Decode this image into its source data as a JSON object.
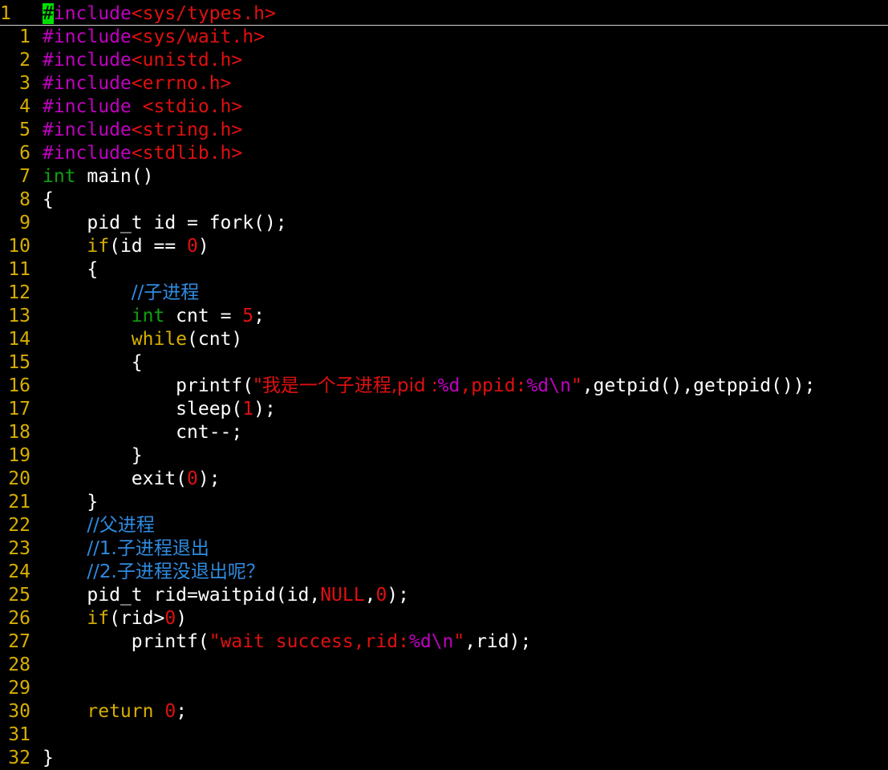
{
  "editor": {
    "colors": {
      "background": "#000000",
      "line_number": "#d7af00",
      "preprocessor": "#c000c0",
      "string": "#e01010",
      "type": "#10a010",
      "keyword": "#d7af00",
      "comment": "#2f8be0",
      "cursor": "#00e000"
    },
    "lines": [
      {
        "n": "1",
        "tokens": [
          {
            "t": "#",
            "c": "cursor"
          },
          {
            "t": "include",
            "c": "pre"
          },
          {
            "t": "<sys/types.h>",
            "c": "str"
          }
        ]
      },
      {
        "n": "1",
        "tokens": [
          {
            "t": "#include",
            "c": "pre"
          },
          {
            "t": "<sys/wait.h>",
            "c": "str"
          }
        ]
      },
      {
        "n": "2",
        "tokens": [
          {
            "t": "#include",
            "c": "pre"
          },
          {
            "t": "<unistd.h>",
            "c": "str"
          }
        ]
      },
      {
        "n": "3",
        "tokens": [
          {
            "t": "#include",
            "c": "pre"
          },
          {
            "t": "<errno.h>",
            "c": "str"
          }
        ]
      },
      {
        "n": "4",
        "tokens": [
          {
            "t": "#include ",
            "c": "pre"
          },
          {
            "t": "<stdio.h>",
            "c": "str"
          }
        ]
      },
      {
        "n": "5",
        "tokens": [
          {
            "t": "#include",
            "c": "pre"
          },
          {
            "t": "<string.h>",
            "c": "str"
          }
        ]
      },
      {
        "n": "6",
        "tokens": [
          {
            "t": "#include",
            "c": "pre"
          },
          {
            "t": "<stdlib.h>",
            "c": "str"
          }
        ]
      },
      {
        "n": "7",
        "tokens": [
          {
            "t": "int",
            "c": "type"
          },
          {
            "t": " main()",
            "c": "def"
          }
        ]
      },
      {
        "n": "8",
        "tokens": [
          {
            "t": "{",
            "c": "def"
          }
        ]
      },
      {
        "n": "9",
        "tokens": [
          {
            "t": "    pid_t id = fork();",
            "c": "def"
          }
        ]
      },
      {
        "n": "10",
        "tokens": [
          {
            "t": "    ",
            "c": "def"
          },
          {
            "t": "if",
            "c": "kw"
          },
          {
            "t": "(id == ",
            "c": "def"
          },
          {
            "t": "0",
            "c": "num"
          },
          {
            "t": ")",
            "c": "def"
          }
        ]
      },
      {
        "n": "11",
        "tokens": [
          {
            "t": "    {",
            "c": "def"
          }
        ]
      },
      {
        "n": "12",
        "tokens": [
          {
            "t": "        ",
            "c": "def"
          },
          {
            "t": "//子进程",
            "c": "cmt"
          }
        ]
      },
      {
        "n": "13",
        "tokens": [
          {
            "t": "        ",
            "c": "def"
          },
          {
            "t": "int",
            "c": "type"
          },
          {
            "t": " cnt = ",
            "c": "def"
          },
          {
            "t": "5",
            "c": "num"
          },
          {
            "t": ";",
            "c": "def"
          }
        ]
      },
      {
        "n": "14",
        "tokens": [
          {
            "t": "        ",
            "c": "def"
          },
          {
            "t": "while",
            "c": "kw"
          },
          {
            "t": "(cnt)",
            "c": "def"
          }
        ]
      },
      {
        "n": "15",
        "tokens": [
          {
            "t": "        {",
            "c": "def"
          }
        ]
      },
      {
        "n": "16",
        "tokens": [
          {
            "t": "            printf(",
            "c": "def"
          },
          {
            "t": "\"我是一个子进程,pid :",
            "c": "str"
          },
          {
            "t": "%d",
            "c": "fmt"
          },
          {
            "t": ",ppid:",
            "c": "str"
          },
          {
            "t": "%d\\n",
            "c": "fmt"
          },
          {
            "t": "\"",
            "c": "str"
          },
          {
            "t": ",getpid(),getppid());",
            "c": "def"
          }
        ]
      },
      {
        "n": "17",
        "tokens": [
          {
            "t": "            sleep(",
            "c": "def"
          },
          {
            "t": "1",
            "c": "num"
          },
          {
            "t": ");",
            "c": "def"
          }
        ]
      },
      {
        "n": "18",
        "tokens": [
          {
            "t": "            cnt--;",
            "c": "def"
          }
        ]
      },
      {
        "n": "19",
        "tokens": [
          {
            "t": "        }",
            "c": "def"
          }
        ]
      },
      {
        "n": "20",
        "tokens": [
          {
            "t": "        exit(",
            "c": "def"
          },
          {
            "t": "0",
            "c": "num"
          },
          {
            "t": ");",
            "c": "def"
          }
        ]
      },
      {
        "n": "21",
        "tokens": [
          {
            "t": "    }",
            "c": "def"
          }
        ]
      },
      {
        "n": "22",
        "tokens": [
          {
            "t": "    ",
            "c": "def"
          },
          {
            "t": "//父进程",
            "c": "cmt"
          }
        ]
      },
      {
        "n": "23",
        "tokens": [
          {
            "t": "    ",
            "c": "def"
          },
          {
            "t": "//1.子进程退出",
            "c": "cmt"
          }
        ]
      },
      {
        "n": "24",
        "tokens": [
          {
            "t": "    ",
            "c": "def"
          },
          {
            "t": "//2.子进程没退出呢？",
            "c": "cmt"
          }
        ]
      },
      {
        "n": "25",
        "tokens": [
          {
            "t": "    pid_t rid=waitpid(id,",
            "c": "def"
          },
          {
            "t": "NULL",
            "c": "num"
          },
          {
            "t": ",",
            "c": "def"
          },
          {
            "t": "0",
            "c": "num"
          },
          {
            "t": ");",
            "c": "def"
          }
        ]
      },
      {
        "n": "26",
        "tokens": [
          {
            "t": "    ",
            "c": "def"
          },
          {
            "t": "if",
            "c": "kw"
          },
          {
            "t": "(rid>",
            "c": "def"
          },
          {
            "t": "0",
            "c": "num"
          },
          {
            "t": ")",
            "c": "def"
          }
        ]
      },
      {
        "n": "27",
        "tokens": [
          {
            "t": "        printf(",
            "c": "def"
          },
          {
            "t": "\"wait success,rid:",
            "c": "str"
          },
          {
            "t": "%d\\n",
            "c": "fmt"
          },
          {
            "t": "\"",
            "c": "str"
          },
          {
            "t": ",rid);",
            "c": "def"
          }
        ]
      },
      {
        "n": "28",
        "tokens": []
      },
      {
        "n": "29",
        "tokens": []
      },
      {
        "n": "30",
        "tokens": [
          {
            "t": "    ",
            "c": "def"
          },
          {
            "t": "return",
            "c": "kw"
          },
          {
            "t": " ",
            "c": "def"
          },
          {
            "t": "0",
            "c": "num"
          },
          {
            "t": ";",
            "c": "def"
          }
        ]
      },
      {
        "n": "31",
        "tokens": []
      },
      {
        "n": "32",
        "tokens": [
          {
            "t": "}",
            "c": "def"
          }
        ]
      }
    ]
  }
}
